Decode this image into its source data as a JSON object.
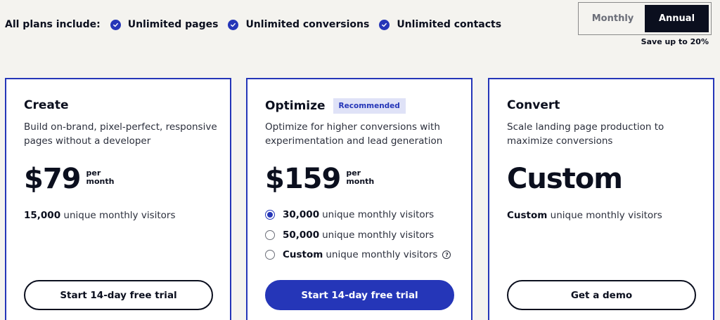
{
  "includes": {
    "lead": "All plans include:",
    "items": [
      "Unlimited pages",
      "Unlimited conversions",
      "Unlimited contacts"
    ]
  },
  "billing": {
    "monthly": "Monthly",
    "annual": "Annual",
    "selected": "Annual",
    "save_note": "Save up to 20%"
  },
  "plans": [
    {
      "title": "Create",
      "description": "Build on-brand, pixel-perfect, responsive pages without a developer",
      "price": "$79",
      "per": "per",
      "period": "month",
      "visitors_count": "15,000",
      "visitors_label": "unique monthly visitors",
      "cta": "Start 14-day free trial"
    },
    {
      "title": "Optimize",
      "badge": "Recommended",
      "description": "Optimize for higher conversions with experimentation and lead generation",
      "price": "$159",
      "per": "per",
      "period": "month",
      "options": [
        {
          "count": "30,000",
          "label": "unique monthly visitors",
          "selected": true
        },
        {
          "count": "50,000",
          "label": "unique monthly visitors",
          "selected": false
        },
        {
          "count": "Custom",
          "label": "unique monthly visitors",
          "selected": false
        }
      ],
      "help_glyph": "?",
      "cta": "Start 14-day free trial"
    },
    {
      "title": "Convert",
      "description": "Scale landing page production to maximize conversions",
      "price": "Custom",
      "visitors_count": "Custom",
      "visitors_label": "unique monthly visitors",
      "cta": "Get a demo"
    }
  ],
  "colors": {
    "accent": "#2536b8",
    "dark": "#0b0f1e",
    "background": "#f4f3ef",
    "badge_bg": "#dfe2f7"
  },
  "icons": {
    "check": "check-circle-icon",
    "radio": "radio-icon",
    "help": "question-circle-icon"
  }
}
